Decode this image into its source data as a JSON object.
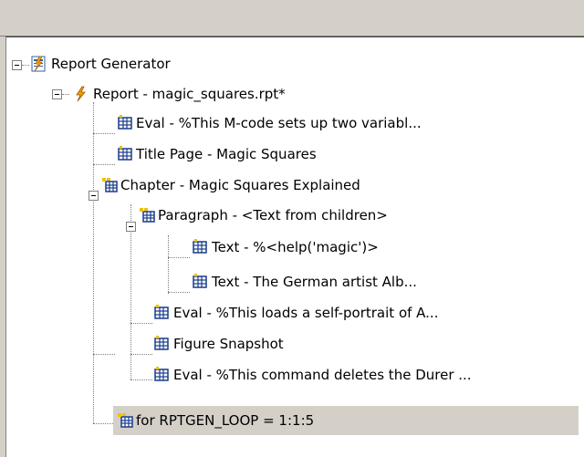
{
  "tree": {
    "items": [
      {
        "label": "Report Generator",
        "icon": "report-generator-icon"
      },
      {
        "label": "Report - magic_squares.rpt*",
        "icon": "lightning-icon"
      },
      {
        "label": "Eval - %This M-code sets up two variabl...",
        "icon": "component-icon"
      },
      {
        "label": "Title Page - Magic Squares",
        "icon": "component-icon"
      },
      {
        "label": "Chapter - Magic Squares Explained",
        "icon": "container-component-icon"
      },
      {
        "label": "Paragraph - <Text from children>",
        "icon": "container-component-icon"
      },
      {
        "label": "Text - %<help('magic')>",
        "icon": "component-icon"
      },
      {
        "label": "Text - The German artist Alb...",
        "icon": "component-icon"
      },
      {
        "label": "Eval - %This loads a self-portrait of A...",
        "icon": "component-icon"
      },
      {
        "label": "Figure Snapshot",
        "icon": "component-icon"
      },
      {
        "label": "Eval - %This command deletes the Durer ...",
        "icon": "component-icon"
      },
      {
        "label": "for RPTGEN_LOOP = 1:1:5",
        "icon": "container-component-icon"
      }
    ]
  },
  "colors": {
    "chrome": "#d4d0c8",
    "selection": "#d4d0c8",
    "text": "#000000",
    "tree_lines": "#808080"
  }
}
